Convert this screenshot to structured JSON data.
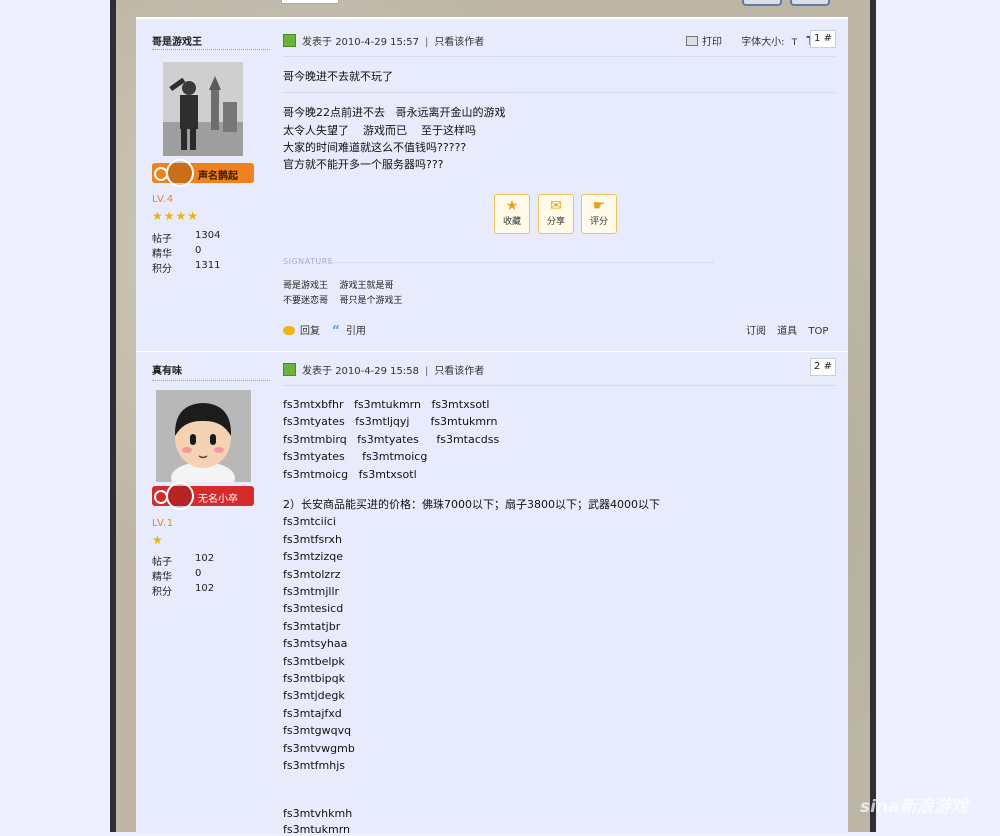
{
  "toolbar": {
    "print": "打印",
    "font_size_label": "字体大小:",
    "font_small": "T",
    "font_large": "T"
  },
  "posts": [
    {
      "author": "哥是游戏王",
      "rank": "声名鹊起",
      "level": "LV.4",
      "stars": 4,
      "stats": [
        {
          "label": "帖子",
          "value": "1304"
        },
        {
          "label": "精华",
          "value": "0"
        },
        {
          "label": "积分",
          "value": "1311"
        }
      ],
      "posted_prefix": "发表于",
      "posted_at": "2010-4-29 15:57",
      "only_author": "只看该作者",
      "floor": "1 #",
      "lines": [
        "哥今晚进不去就不玩了",
        "哥今晚22点前进不去   哥永远离开金山的游戏",
        "太令人失望了    游戏而已    至于这样吗",
        "大家的时间难道就这么不值钱吗?????",
        "官方就不能开多一个服务器吗???"
      ],
      "actions": [
        {
          "icon": "star-icon",
          "glyph": "★",
          "label": "收藏"
        },
        {
          "icon": "share-icon",
          "glyph": "✉",
          "label": "分享"
        },
        {
          "icon": "rate-icon",
          "glyph": "☛",
          "label": "评分"
        }
      ],
      "signature_label": "SIGNATURE",
      "signature": [
        "哥是游戏王    游戏王就是哥",
        "不要迷恋哥    哥只是个游戏王"
      ],
      "reply": "回复",
      "quote": "引用",
      "subscribe": "订阅",
      "tools": "道具",
      "top": "TOP",
      "colors": {
        "badge": "#f0811c"
      }
    },
    {
      "author": "真有味",
      "rank": "无名小卒",
      "level": "LV.1",
      "stars": 1,
      "stats": [
        {
          "label": "帖子",
          "value": "102"
        },
        {
          "label": "精华",
          "value": "0"
        },
        {
          "label": "积分",
          "value": "102"
        }
      ],
      "posted_prefix": "发表于",
      "posted_at": "2010-4-29 15:58",
      "only_author": "只看该作者",
      "floor": "2 #",
      "lines": [
        "fs3mtxbfhr   fs3mtukmrn   fs3mtxsotl",
        "fs3mtyates   fs3mtljqyj      fs3mtukmrn",
        "fs3mtmbirq   fs3mtyates     fs3mtacdss",
        "fs3mtyates     fs3mtmoicg",
        "fs3mtmoicg   fs3mtxsotl",
        "2）长安商品能买进的价格：佛珠7000以下；扇子3800以下；武器4000以下",
        "fs3mtciici",
        "fs3mtfsrxh",
        "fs3mtzizqe",
        "fs3mtolzrz",
        "fs3mtmjllr",
        "fs3mtesicd",
        "fs3mtatjbr",
        "fs3mtsyhaa",
        "fs3mtbelpk",
        "fs3mtbipqk",
        "fs3mtjdegk",
        "fs3mtajfxd",
        "fs3mtgwqvq",
        "fs3mtvwgmb",
        "fs3mtfmhjs",
        "fs3mtvhkmh",
        "fs3mtukmrn"
      ],
      "colors": {
        "badge": "#d62b2b"
      }
    }
  ],
  "watermark": "sina新浪游戏"
}
